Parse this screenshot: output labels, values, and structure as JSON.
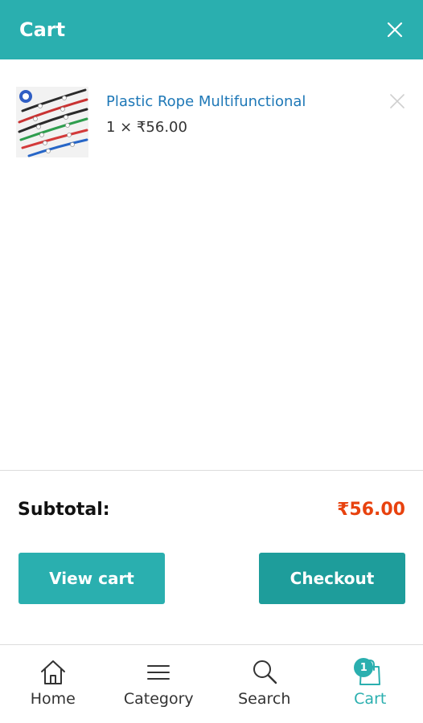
{
  "header": {
    "title": "Cart"
  },
  "cart": {
    "items": [
      {
        "name": "Plastic Rope Multifunctional",
        "price": "1 × ₹56.00"
      }
    ]
  },
  "summary": {
    "subtotal_label": "Subtotal:",
    "subtotal_value": "₹56.00"
  },
  "actions": {
    "view_cart": "View cart",
    "checkout": "Checkout"
  },
  "nav": {
    "items": [
      {
        "label": "Home",
        "icon": "home-icon"
      },
      {
        "label": "Category",
        "icon": "menu-icon"
      },
      {
        "label": "Search",
        "icon": "search-icon"
      },
      {
        "label": "Cart",
        "icon": "shopping-bag-icon",
        "badge": "1"
      }
    ]
  },
  "colors": {
    "accent": "#2aafaf",
    "price": "#e8420e",
    "link": "#1e78b7"
  }
}
